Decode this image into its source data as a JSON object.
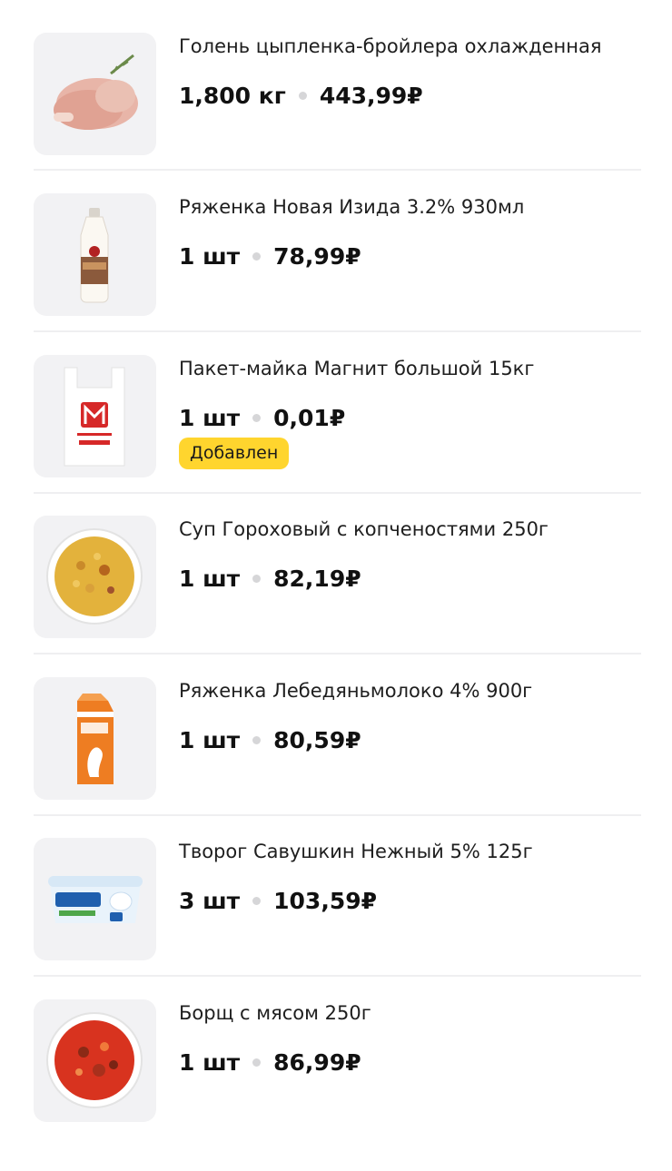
{
  "cart": {
    "items": [
      {
        "title": "Голень цыпленка-бройлера охлажденная",
        "quantity": "1,800 кг",
        "price": "443,99₽",
        "image": "chicken-drumstick-image"
      },
      {
        "title": "Ряженка Новая Изида 3.2% 930мл",
        "quantity": "1 шт",
        "price": "78,99₽",
        "image": "ryazhenka-bottle-image"
      },
      {
        "title": "Пакет-майка Магнит большой 15кг",
        "quantity": "1 шт",
        "price": "0,01₽",
        "image": "magnit-bag-image",
        "badge": "Добавлен"
      },
      {
        "title": "Суп Гороховый с копченостями 250г",
        "quantity": "1 шт",
        "price": "82,19₽",
        "image": "pea-soup-image"
      },
      {
        "title": "Ряженка Лебедяньмолоко 4% 900г",
        "quantity": "1 шт",
        "price": "80,59₽",
        "image": "ryazhenka-carton-image"
      },
      {
        "title": "Творог Савушкин Нежный 5% 125г",
        "quantity": "3 шт",
        "price": "103,59₽",
        "image": "savushkin-cottage-cheese-image"
      },
      {
        "title": "Борщ с мясом 250г",
        "quantity": "1 шт",
        "price": "86,99₽",
        "image": "borscht-image"
      }
    ]
  },
  "colors": {
    "badge": "#ffd52e",
    "thumb_bg": "#f2f2f4",
    "divider": "#efeff1"
  }
}
